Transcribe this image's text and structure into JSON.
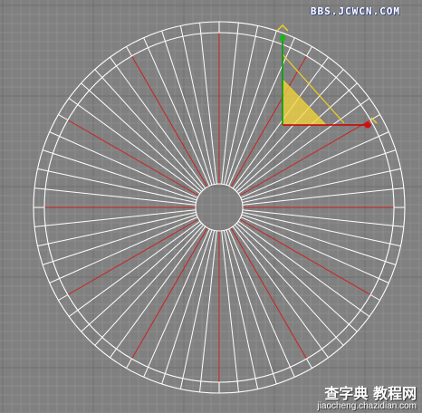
{
  "viewport": {
    "background": "#808080",
    "grid_minor_color": "#909090",
    "grid_major_color": "#6f6f6f"
  },
  "wheel": {
    "spoke_count": 60,
    "highlight_every": 5,
    "spoke_color": "#ffffff",
    "highlight_color": "#cc2020",
    "rim_color": "#ffffff"
  },
  "gizmo": {
    "x_axis_color": "#cc0000",
    "y_axis_color": "#00aa00",
    "plane_color": "#f5d63b",
    "center_color": "#f0d020",
    "icon": "move-transform-gizmo-icon"
  },
  "watermarks": {
    "top": "BBS.JCWCN.COM",
    "bottom_chinese": "查字典 教程网",
    "bottom_url": "jiaocheng.chazidian.com"
  }
}
